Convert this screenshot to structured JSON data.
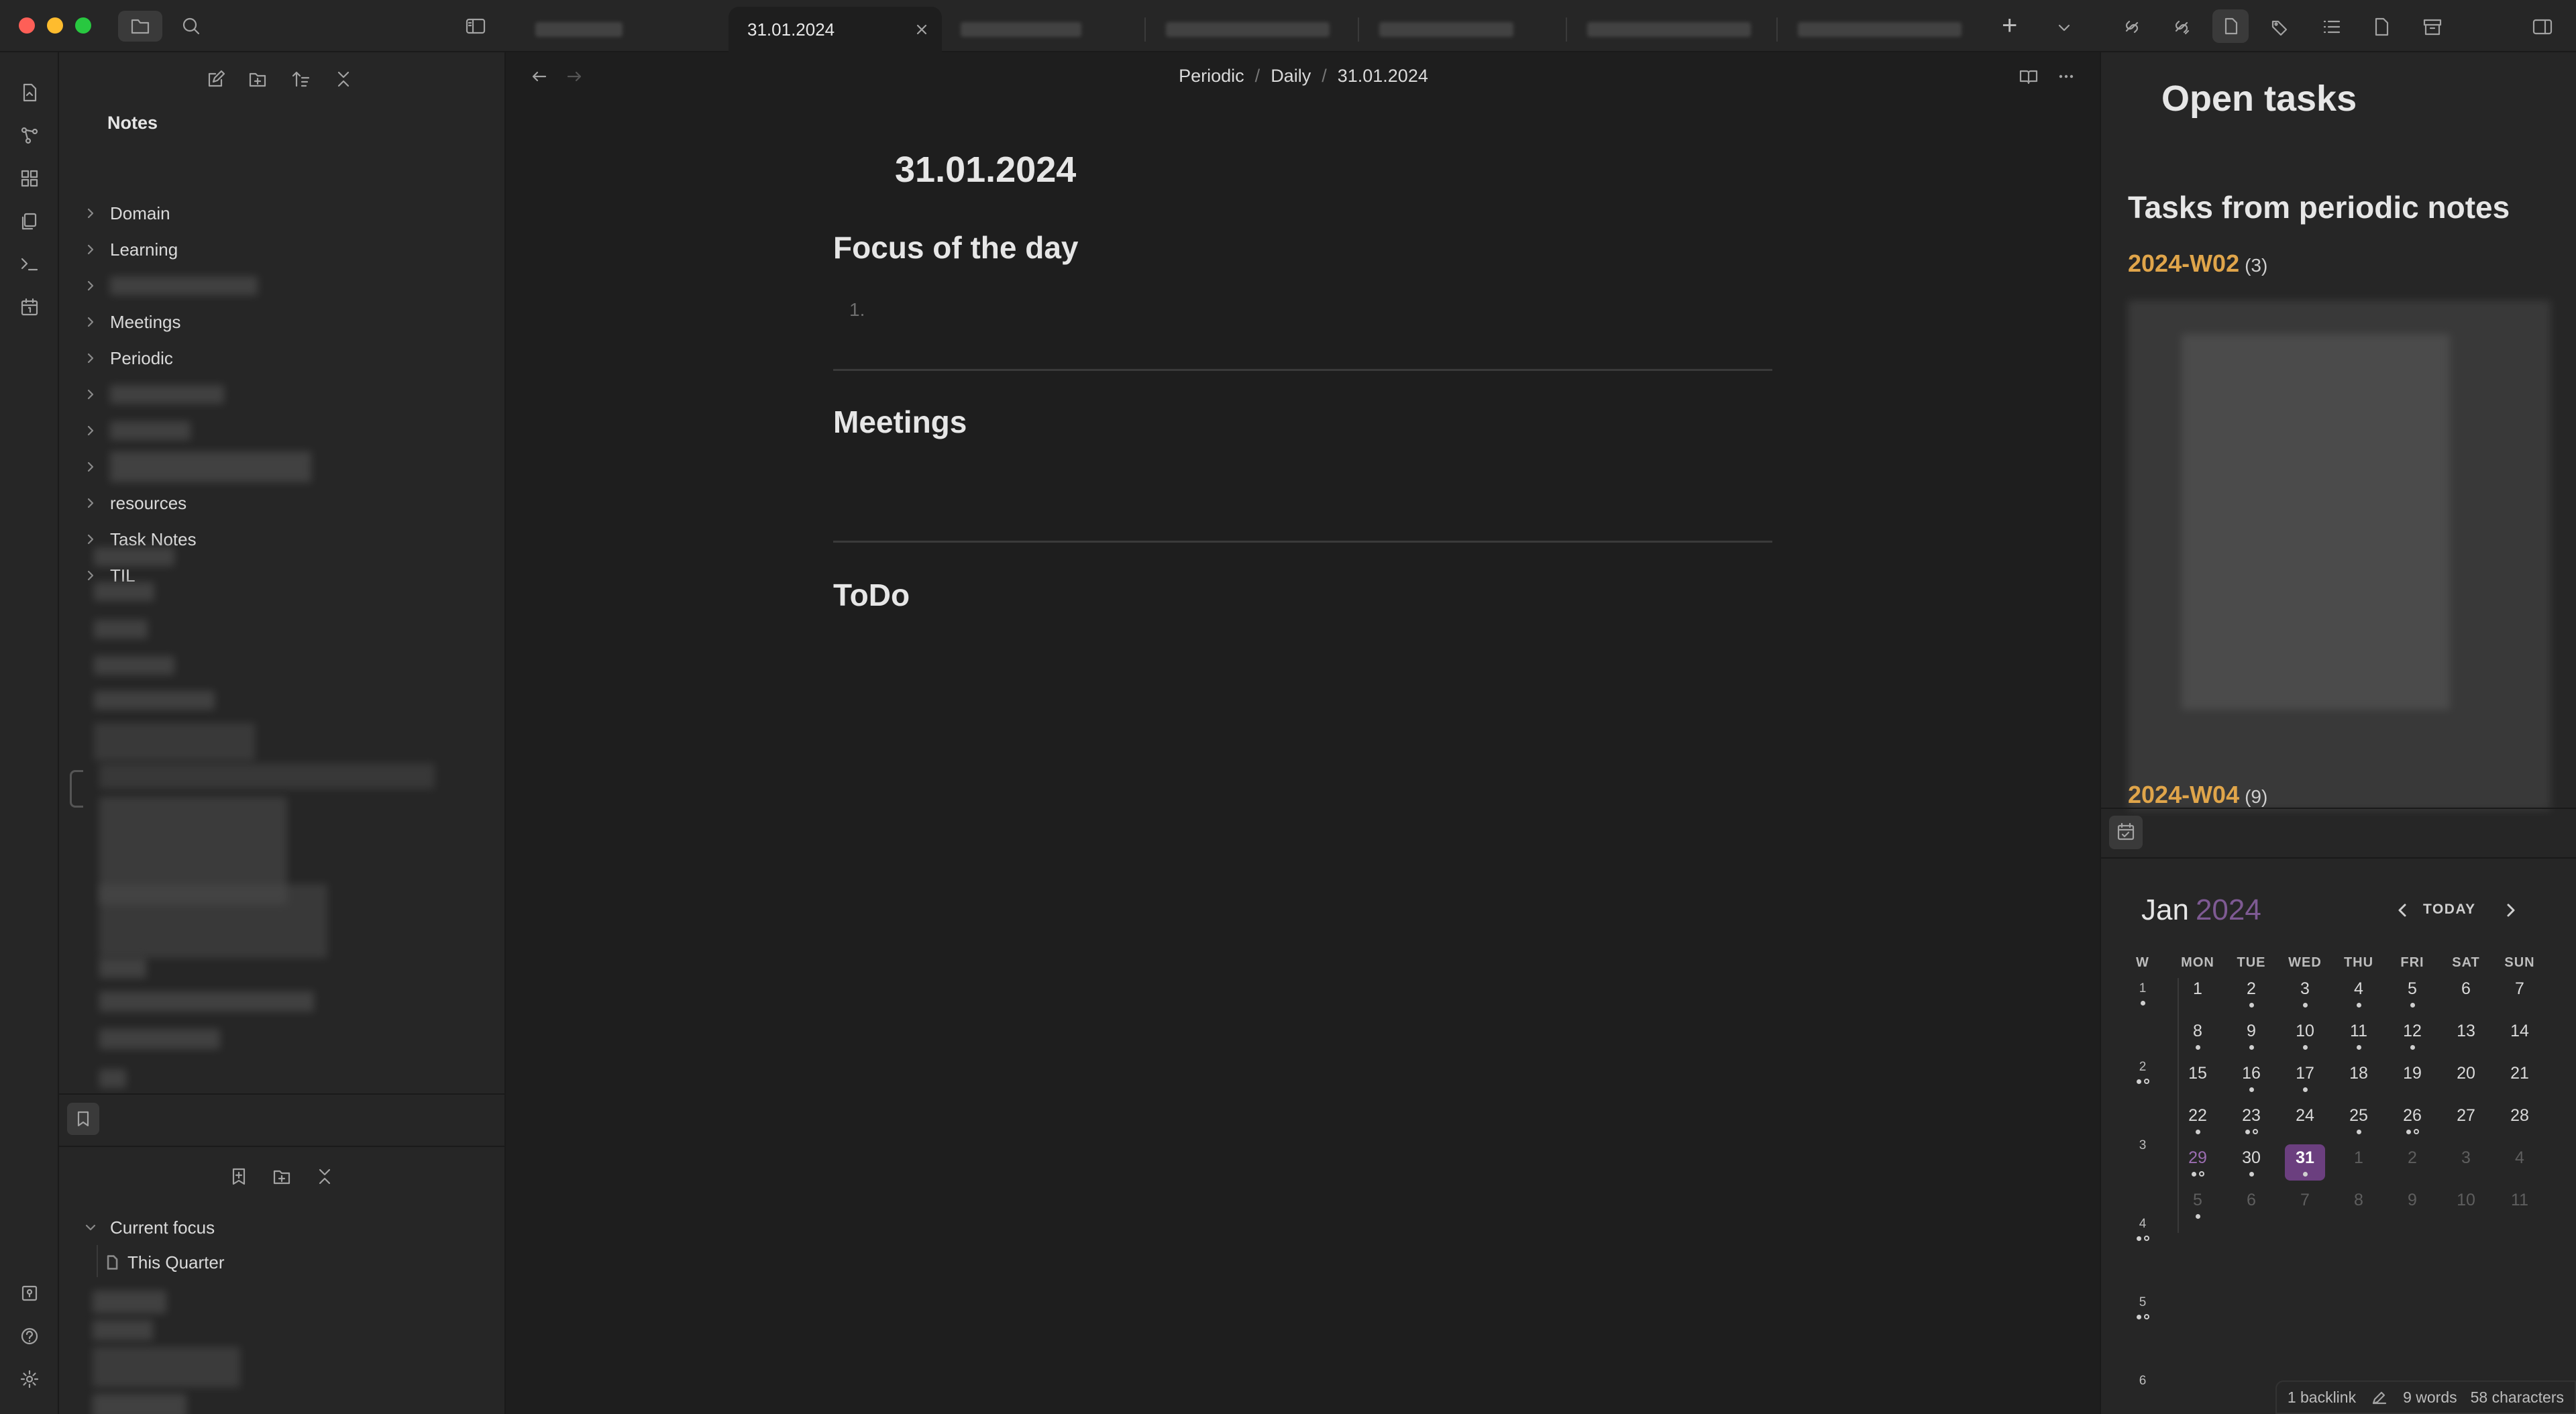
{
  "titlebar": {
    "tabs": [
      {
        "label": "",
        "blurred": true
      },
      {
        "label": "31.01.2024",
        "active": true
      },
      {
        "label": "",
        "blurred": true
      },
      {
        "label": "",
        "blurred": true
      },
      {
        "label": "",
        "blurred": true
      },
      {
        "label": "",
        "blurred": true
      },
      {
        "label": "",
        "blurred": true
      }
    ],
    "new_tab": "+",
    "tab_list": "⌄"
  },
  "sidebar": {
    "root_label": "Notes",
    "folders": [
      {
        "label": "Domain"
      },
      {
        "label": "Learning"
      },
      {
        "label": ""
      },
      {
        "label": "Meetings"
      },
      {
        "label": "Periodic"
      },
      {
        "label": ""
      },
      {
        "label": ""
      },
      {
        "label": ""
      },
      {
        "label": "resources"
      },
      {
        "label": "Task Notes"
      },
      {
        "label": "TIL"
      }
    ],
    "bookmarks": {
      "group_label": "Current focus",
      "item_label": "This Quarter"
    }
  },
  "editor": {
    "breadcrumb": [
      "Periodic",
      "Daily",
      "31.01.2024"
    ],
    "breadcrumb_sep": "/",
    "title": "31.01.2024",
    "sections": [
      {
        "heading": "Focus of the day",
        "list_marker": "1."
      },
      {
        "heading": "Meetings"
      },
      {
        "heading": "ToDo"
      }
    ]
  },
  "right_panel": {
    "title": "Open tasks",
    "subtitle": "Tasks from periodic notes",
    "groups": [
      {
        "label": "2024-W02",
        "count": "(3)"
      },
      {
        "label": "2024-W04",
        "count": "(9)"
      }
    ],
    "calendar": {
      "month": "Jan",
      "year": "2024",
      "today_label": "TODAY",
      "weekday_headers": [
        "W",
        "MON",
        "TUE",
        "WED",
        "THU",
        "FRI",
        "SAT",
        "SUN"
      ],
      "weeks": [
        {
          "week": "1",
          "wdots": "d",
          "days": [
            [
              "1",
              ""
            ],
            [
              "2",
              "d"
            ],
            [
              "3",
              "d"
            ],
            [
              "4",
              "d"
            ],
            [
              "5",
              "d"
            ],
            [
              "6",
              ""
            ],
            [
              "7",
              ""
            ]
          ]
        },
        {
          "week": "2",
          "wdots": "do",
          "days": [
            [
              "8",
              "d"
            ],
            [
              "9",
              "d"
            ],
            [
              "10",
              "d"
            ],
            [
              "11",
              "d"
            ],
            [
              "12",
              "d"
            ],
            [
              "13",
              ""
            ],
            [
              "14",
              ""
            ]
          ]
        },
        {
          "week": "3",
          "wdots": "",
          "days": [
            [
              "15",
              ""
            ],
            [
              "16",
              "d"
            ],
            [
              "17",
              "d"
            ],
            [
              "18",
              ""
            ],
            [
              "19",
              ""
            ],
            [
              "20",
              ""
            ],
            [
              "21",
              ""
            ]
          ]
        },
        {
          "week": "4",
          "wdots": "do",
          "days": [
            [
              "22",
              "d"
            ],
            [
              "23",
              "do"
            ],
            [
              "24",
              ""
            ],
            [
              "25",
              "d"
            ],
            [
              "26",
              "do"
            ],
            [
              "27",
              ""
            ],
            [
              "28",
              ""
            ]
          ]
        },
        {
          "week": "5",
          "wdots": "do",
          "days": [
            [
              "29",
              "do"
            ],
            [
              "30",
              "d"
            ],
            [
              "31",
              "d"
            ],
            [
              "1",
              ""
            ],
            [
              "2",
              ""
            ],
            [
              "3",
              ""
            ],
            [
              "4",
              ""
            ]
          ]
        },
        {
          "week": "6",
          "wdots": "",
          "days": [
            [
              "5",
              "d"
            ],
            [
              "6",
              ""
            ],
            [
              "7",
              ""
            ],
            [
              "8",
              ""
            ],
            [
              "9",
              ""
            ],
            [
              "10",
              ""
            ],
            [
              "11",
              ""
            ]
          ]
        }
      ],
      "muted_from": [
        [
          4,
          3
        ],
        [
          5,
          0
        ]
      ],
      "today_cell": [
        4,
        2
      ],
      "purple_cell": [
        4,
        0
      ]
    }
  },
  "status": {
    "backlinks": "1 backlink",
    "words": "9 words",
    "characters": "58 characters"
  },
  "colors": {
    "accent_purple": "#6b3f7f",
    "year_purple": "#7e5a93",
    "task_orange": "#e0a54a",
    "bg_main": "#1e1e1e",
    "bg_panel": "#262626"
  }
}
